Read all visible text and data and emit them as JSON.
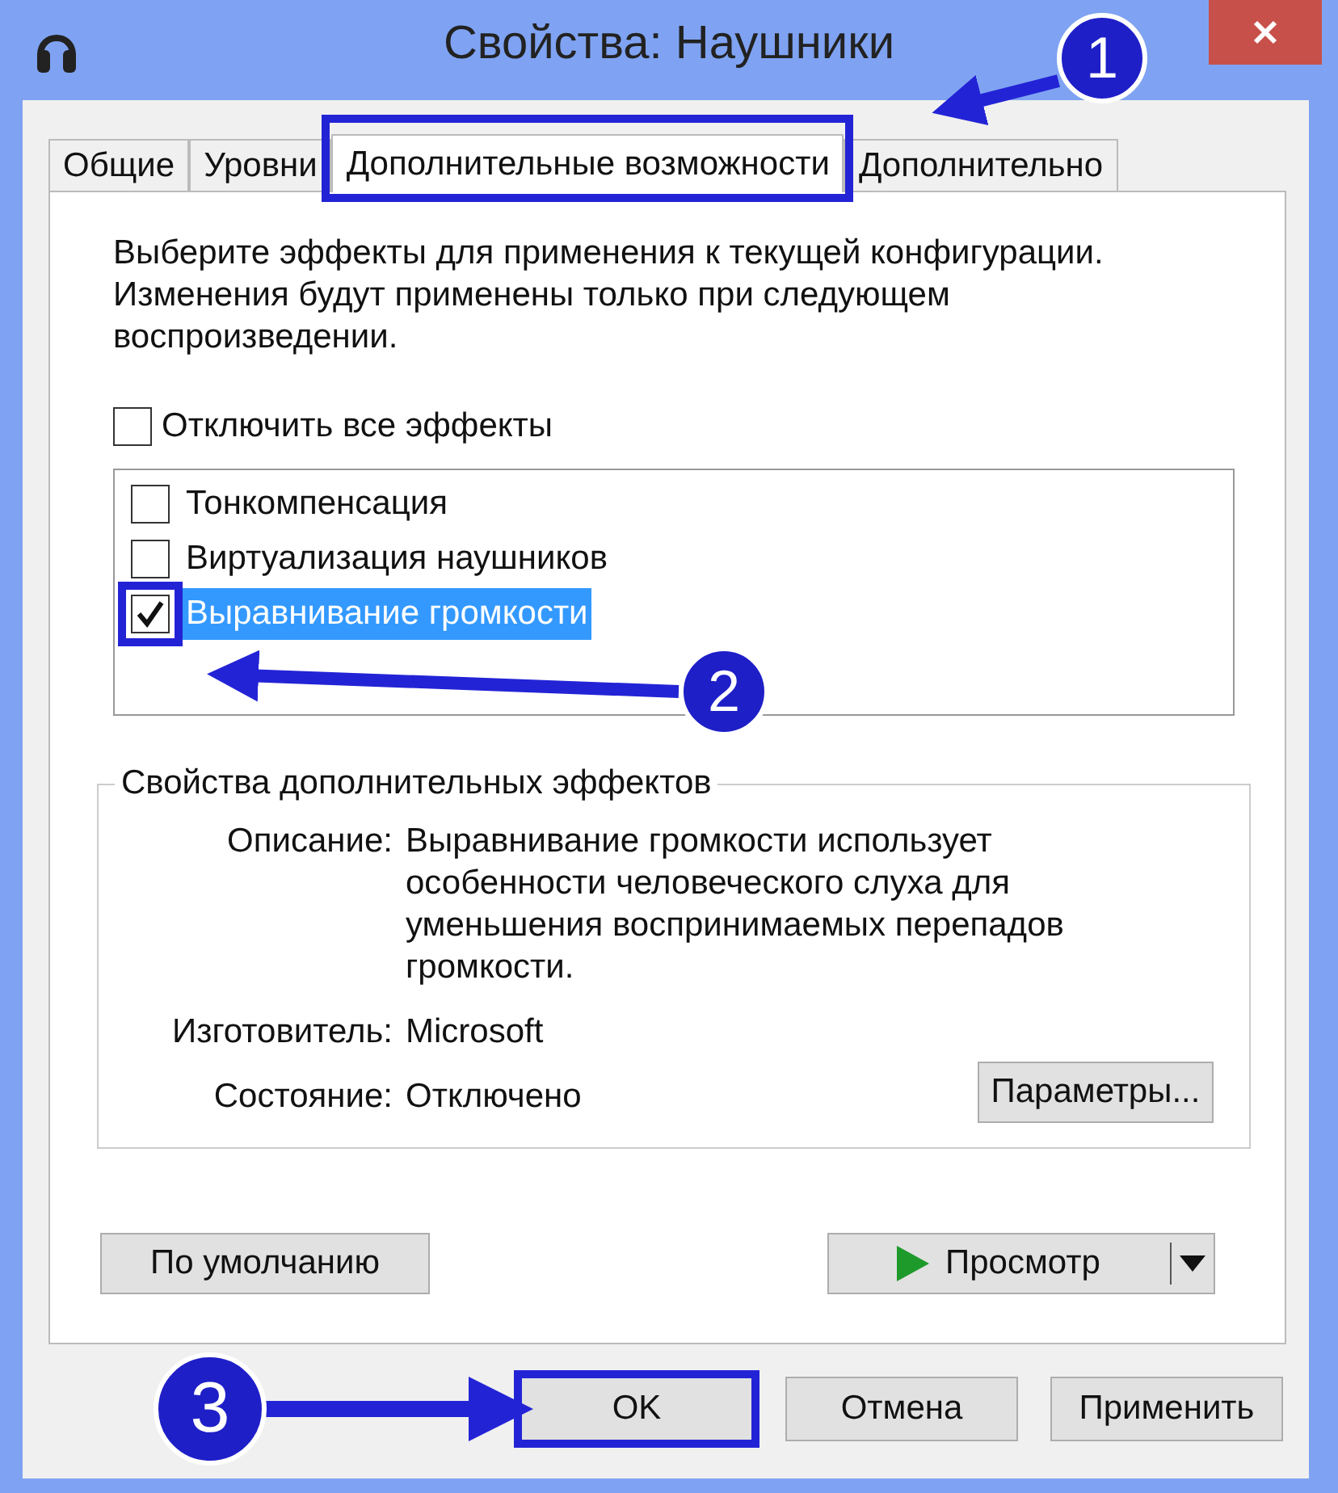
{
  "window": {
    "title": "Свойства: Наушники"
  },
  "tabs": [
    {
      "label": "Общие",
      "selected": false
    },
    {
      "label": "Уровни",
      "selected": false
    },
    {
      "label": "Дополнительные возможности",
      "selected": true
    },
    {
      "label": "Дополнительно",
      "selected": false
    }
  ],
  "intro": "Выберите эффекты для применения к текущей конфигурации. Изменения будут применены только при следующем воспроизведении.",
  "disable_all": {
    "label": "Отключить все эффекты",
    "checked": false
  },
  "effects": [
    {
      "label": "Тонкомпенсация",
      "checked": false,
      "selected": false
    },
    {
      "label": "Виртуализация наушников",
      "checked": false,
      "selected": false
    },
    {
      "label": "Выравнивание громкости",
      "checked": true,
      "selected": true
    }
  ],
  "properties": {
    "title": "Свойства дополнительных эффектов",
    "rows": [
      {
        "label": "Описание:",
        "value": "Выравнивание громкости использует особенности человеческого слуха для уменьшения воспринимаемых перепадов громкости."
      },
      {
        "label": "Изготовитель:",
        "value": "Microsoft"
      },
      {
        "label": "Состояние:",
        "value": "Отключено"
      }
    ],
    "settings_button": "Параметры..."
  },
  "defaults_button": "По умолчанию",
  "preview_button": "Просмотр",
  "dialog_buttons": [
    {
      "label": "OK",
      "highlighted": true
    },
    {
      "label": "Отмена",
      "highlighted": false
    },
    {
      "label": "Применить",
      "highlighted": false
    }
  ],
  "annotations": [
    {
      "label": "1"
    },
    {
      "label": "2"
    },
    {
      "label": "3"
    }
  ]
}
